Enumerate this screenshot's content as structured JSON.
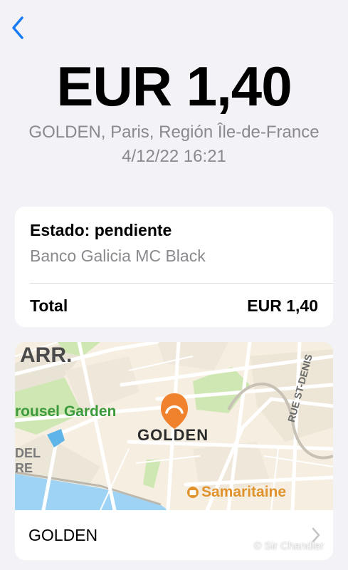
{
  "nav": {
    "back_icon": "chevron-left-icon"
  },
  "transaction": {
    "amount": "EUR 1,40",
    "merchant_location": "GOLDEN, Paris, Región Île-de-France",
    "datetime": "4/12/22 16:21"
  },
  "status_card": {
    "status": "Estado: pendiente",
    "card_name": "Banco Galicia MC Black",
    "total_label": "Total",
    "total_value": "EUR 1,40"
  },
  "map": {
    "labels": {
      "arrondissement": "ARR.",
      "garden": "rousel Garden",
      "merchant": "GOLDEN",
      "street": "RUE ST-DENIS",
      "store": "Samaritaine",
      "edge1": "DEL",
      "edge2": "RE"
    },
    "pin_icon": "croissant-icon",
    "store_icon": "shopping-bag-icon",
    "footer_label": "GOLDEN",
    "footer_chevron": "chevron-right-icon"
  },
  "watermark": "© Sir Chandler",
  "colors": {
    "accent": "#1a7cf5",
    "pin": "#f0822e",
    "park": "#cfe7b3",
    "river": "#9ed3f5",
    "store": "#e0922c",
    "garden_text": "#3c9a3c"
  }
}
